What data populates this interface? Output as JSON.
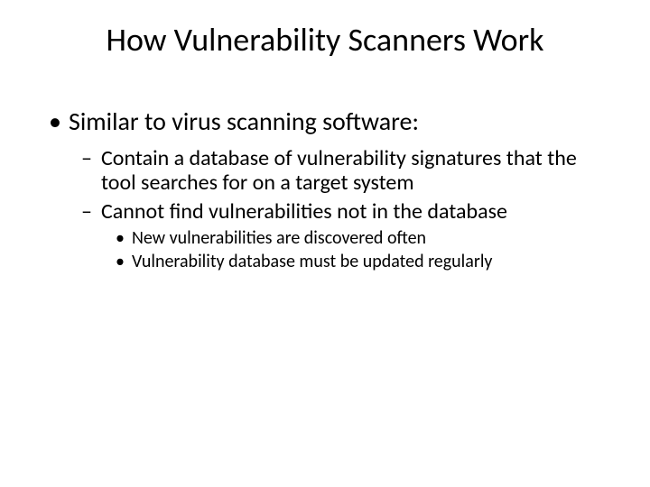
{
  "title": "How Vulnerability Scanners Work",
  "body": {
    "l1": "Similar to virus scanning software:",
    "l2a": "Contain a database of vulnerability signatures that the tool searches for on a target system",
    "l2b": "Cannot find vulnerabilities not in the database",
    "l3a": "New vulnerabilities are discovered often",
    "l3b": "Vulnerability database must be updated regularly"
  }
}
